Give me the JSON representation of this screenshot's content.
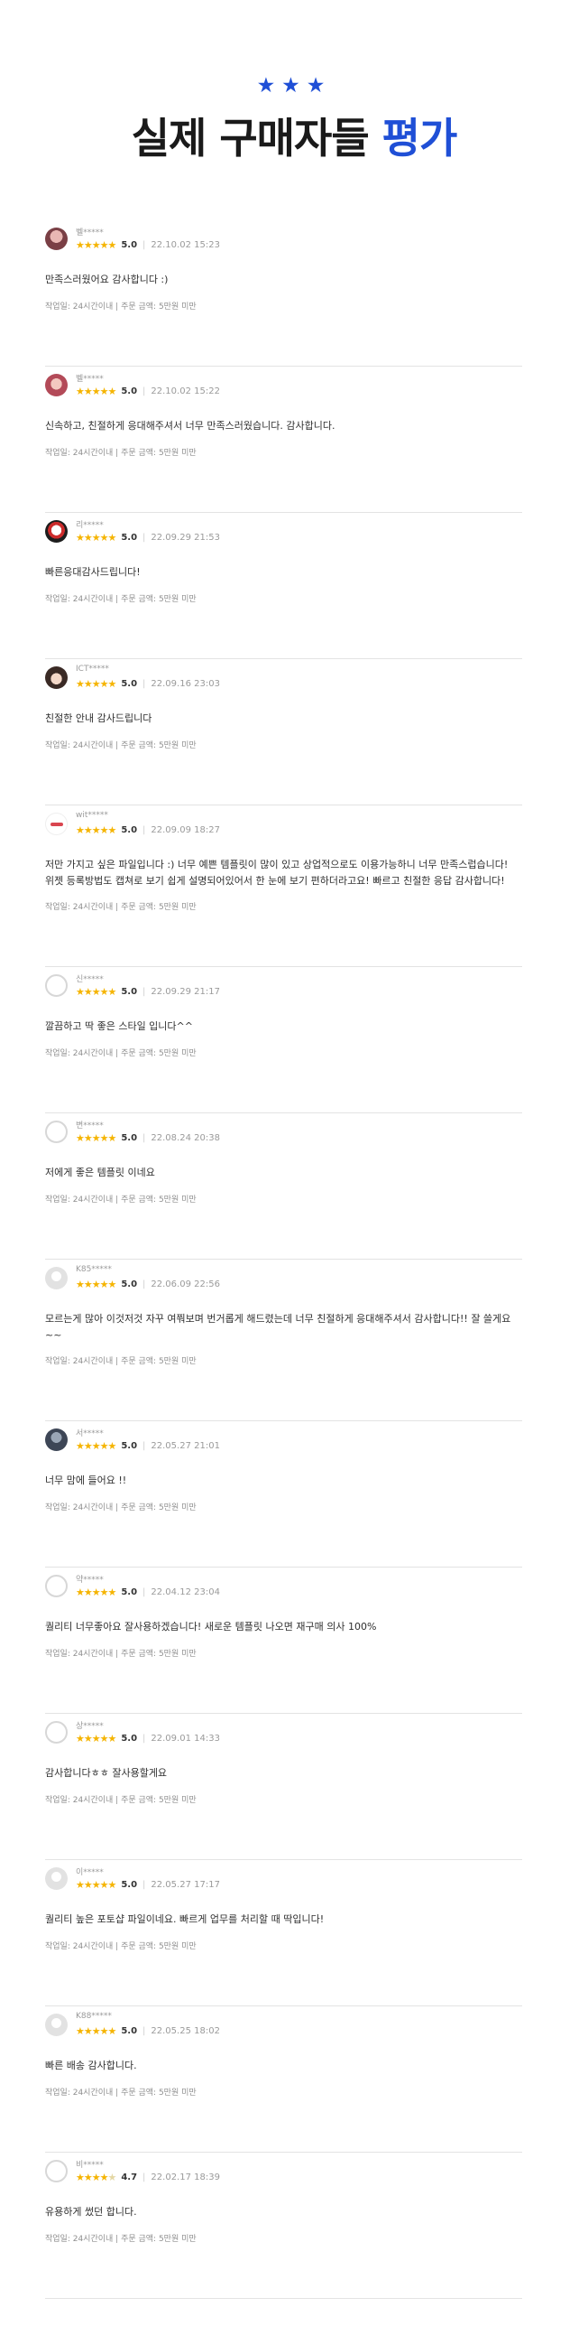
{
  "header": {
    "stars": "★★★",
    "title_main": "실제 구매자들",
    "title_accent": "평가",
    "accent_color": "#1f4fd6"
  },
  "reviews": [
    {
      "user": "벨*****",
      "stars": "★★★★★",
      "stars_dim": "",
      "score": "5.0",
      "date": "22.10.02 15:23",
      "content": "만족스러웠어요 감사합니다 :)",
      "work_time": "작업일: 24시간이내",
      "price": "주문 금액: 5만원 미만",
      "avatar": "photo-a"
    },
    {
      "user": "벨*****",
      "stars": "★★★★★",
      "stars_dim": "",
      "score": "5.0",
      "date": "22.10.02 15:22",
      "content": "신속하고, 친절하게 응대해주셔서 너무 만족스러웠습니다. 감사합니다.",
      "work_time": "작업일: 24시간이내",
      "price": "주문 금액: 5만원 미만",
      "avatar": "photo-b"
    },
    {
      "user": "리*****",
      "stars": "★★★★★",
      "stars_dim": "",
      "score": "5.0",
      "date": "22.09.29 21:53",
      "content": "빠른응대감사드립니다!",
      "work_time": "작업일: 24시간이내",
      "price": "주문 금액: 5만원 미만",
      "avatar": "photo-c"
    },
    {
      "user": "ICT*****",
      "stars": "★★★★★",
      "stars_dim": "",
      "score": "5.0",
      "date": "22.09.16 23:03",
      "content": "친절한 안내 감사드립니다",
      "work_time": "작업일: 24시간이내",
      "price": "주문 금액: 5만원 미만",
      "avatar": "photo-d"
    },
    {
      "user": "wit*****",
      "stars": "★★★★★",
      "stars_dim": "",
      "score": "5.0",
      "date": "22.09.09 18:27",
      "content": "저만 가지고 싶은 파일입니다 :) 너무 예쁜 템플릿이 많이 있고 상업적으로도 이용가능하니 너무 만족스럽습니다! 위젯 등록방법도 캡쳐로 보기 쉽게 설명되어있어서 한 눈에 보기 편하더라고요! 빠르고 친절한 응답 감사합니다!",
      "work_time": "작업일: 24시간이내",
      "price": "주문 금액: 5만원 미만",
      "avatar": "photo-e"
    },
    {
      "user": "신*****",
      "stars": "★★★★★",
      "stars_dim": "",
      "score": "5.0",
      "date": "22.09.29 21:17",
      "content": "깔끔하고 딱 좋은 스타일 입니다^^",
      "work_time": "작업일: 24시간이내",
      "price": "주문 금액: 5만원 미만",
      "avatar": "ring"
    },
    {
      "user": "변*****",
      "stars": "★★★★★",
      "stars_dim": "",
      "score": "5.0",
      "date": "22.08.24 20:38",
      "content": "저에게 좋은 템플릿 이네요",
      "work_time": "작업일: 24시간이내",
      "price": "주문 금액: 5만원 미만",
      "avatar": "ring"
    },
    {
      "user": "K85*****",
      "stars": "★★★★★",
      "stars_dim": "",
      "score": "5.0",
      "date": "22.06.09 22:56",
      "content": "모르는게 많아 이것저것 자꾸 여쭤보며 번거롭게 해드렸는데 너무 친절하게 응대해주셔서 감사합니다!! 잘 쓸게요~~",
      "work_time": "작업일: 24시간이내",
      "price": "주문 금액: 5만원 미만",
      "avatar": "photo-f"
    },
    {
      "user": "서*****",
      "stars": "★★★★★",
      "stars_dim": "",
      "score": "5.0",
      "date": "22.05.27 21:01",
      "content": "너무 맘에 들어요 !!",
      "work_time": "작업일: 24시간이내",
      "price": "주문 금액: 5만원 미만",
      "avatar": "photo-g"
    },
    {
      "user": "약*****",
      "stars": "★★★★★",
      "stars_dim": "",
      "score": "5.0",
      "date": "22.04.12 23:04",
      "content": "퀄리티 너무좋아요 잘사용하겠습니다! 새로운 템플릿 나오면 재구매 의사 100%",
      "work_time": "작업일: 24시간이내",
      "price": "주문 금액: 5만원 미만",
      "avatar": "ring"
    },
    {
      "user": "상*****",
      "stars": "★★★★★",
      "stars_dim": "",
      "score": "5.0",
      "date": "22.09.01 14:33",
      "content": "감사합니다ㅎㅎ 잘사용할게요",
      "work_time": "작업일: 24시간이내",
      "price": "주문 금액: 5만원 미만",
      "avatar": "ring"
    },
    {
      "user": "이*****",
      "stars": "★★★★★",
      "stars_dim": "",
      "score": "5.0",
      "date": "22.05.27 17:17",
      "content": "퀄리티 높은 포토샵 파일이네요. 빠르게 업무를 처리할 때 딱입니다!",
      "work_time": "작업일: 24시간이내",
      "price": "주문 금액: 5만원 미만",
      "avatar": "photo-f"
    },
    {
      "user": "K88*****",
      "stars": "★★★★★",
      "stars_dim": "",
      "score": "5.0",
      "date": "22.05.25 18:02",
      "content": "빠른 배송 감사합니다.",
      "work_time": "작업일: 24시간이내",
      "price": "주문 금액: 5만원 미만",
      "avatar": "photo-f"
    },
    {
      "user": "비*****",
      "stars": "★★★★",
      "stars_dim": "★",
      "score": "4.7",
      "date": "22.02.17 18:39",
      "content": "유용하게 썼던 합니다.",
      "work_time": "작업일: 24시간이내",
      "price": "주문 금액: 5만원 미만",
      "avatar": "ring"
    }
  ]
}
